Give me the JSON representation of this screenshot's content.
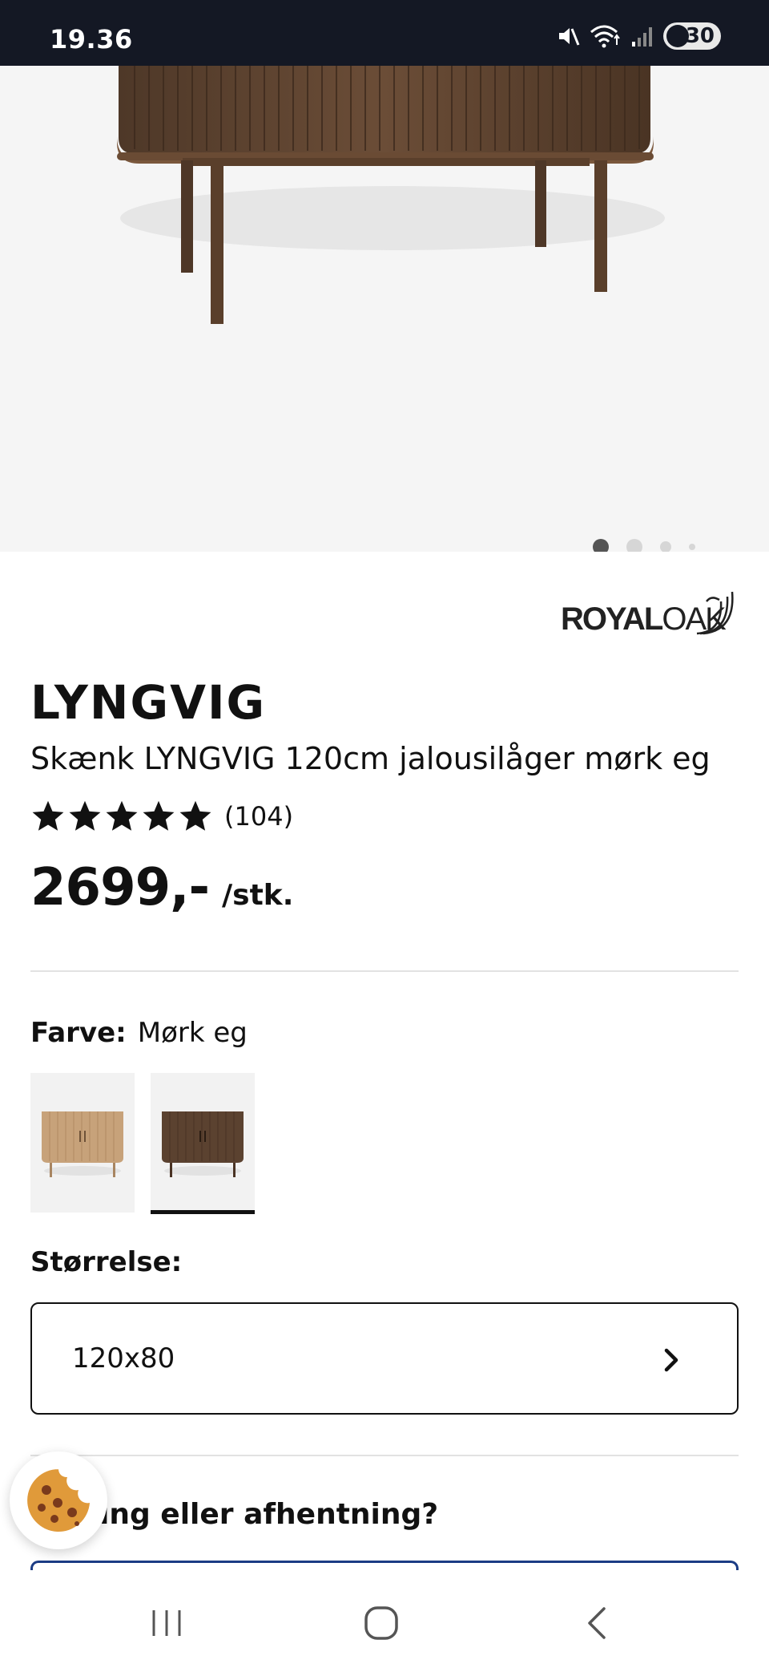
{
  "status_bar": {
    "time": "19.36",
    "battery": "30",
    "icons": [
      "mute-icon",
      "wifi-icon",
      "signal-icon",
      "battery-saver-icon"
    ]
  },
  "gallery": {
    "image_alt": "Skænk LYNGVIG mørk eg",
    "page_count": 4,
    "active_index": 0
  },
  "brand": {
    "part1": "ROYAL",
    "part2": "OAK",
    "tm": "™"
  },
  "product": {
    "name": "LYNGVIG",
    "description": "Skænk LYNGVIG 120cm jalousilåger mørk eg",
    "rating_stars": 5,
    "review_count": "(104)",
    "price": "2699,-",
    "price_unit": "/stk."
  },
  "color": {
    "label": "Farve:",
    "value": "Mørk eg",
    "options": [
      {
        "name": "Lys eg",
        "color": "#c8a47c",
        "selected": false
      },
      {
        "name": "Mørk eg",
        "color": "#5a4231",
        "selected": true
      }
    ]
  },
  "size": {
    "label": "Størrelse:",
    "value": "120x80"
  },
  "delivery": {
    "heading": "ing eller afhentning?"
  },
  "colors": {
    "status_bar_bg": "#141824",
    "hero_bg": "#f5f5f5",
    "accent_blue": "#1b3c84",
    "wood_dark": "#5e4431",
    "cookie": "#e09a3a"
  }
}
